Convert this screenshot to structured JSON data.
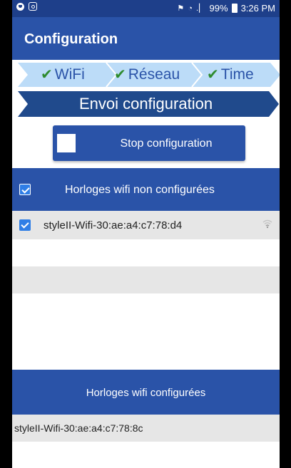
{
  "statusbar": {
    "signal": "⚑ ◔ .▏",
    "battery": "99%",
    "time": "3:26 PM"
  },
  "appbar": {
    "title": "Configuration"
  },
  "steps": {
    "items": [
      {
        "label": "WiFi",
        "done": true
      },
      {
        "label": "Réseau",
        "done": true
      },
      {
        "label": "Time",
        "done": true
      }
    ],
    "current": "Envoi configuration",
    "colors": {
      "pending": "#bcdcf8",
      "active": "#204a8c",
      "check": "#2e8b2e"
    }
  },
  "stop_button": {
    "label": "Stop configuration",
    "checked": false
  },
  "unconfigured": {
    "header": "Horloges wifi non configurées",
    "header_checked": true,
    "items": [
      {
        "label": "styleII-Wifi-30:ae:a4:c7:78:d4",
        "checked": true,
        "icon": "wifi-signal-icon"
      }
    ]
  },
  "configured": {
    "header": "Horloges wifi configurées",
    "items": [
      {
        "label": "styleII-Wifi-30:ae:a4:c7:78:8c"
      }
    ]
  },
  "colors": {
    "primary": "#2a53a8",
    "statusbar": "#1e3f8a",
    "checkbox": "#2f7ee6",
    "row_grey": "#e6e6e6"
  }
}
